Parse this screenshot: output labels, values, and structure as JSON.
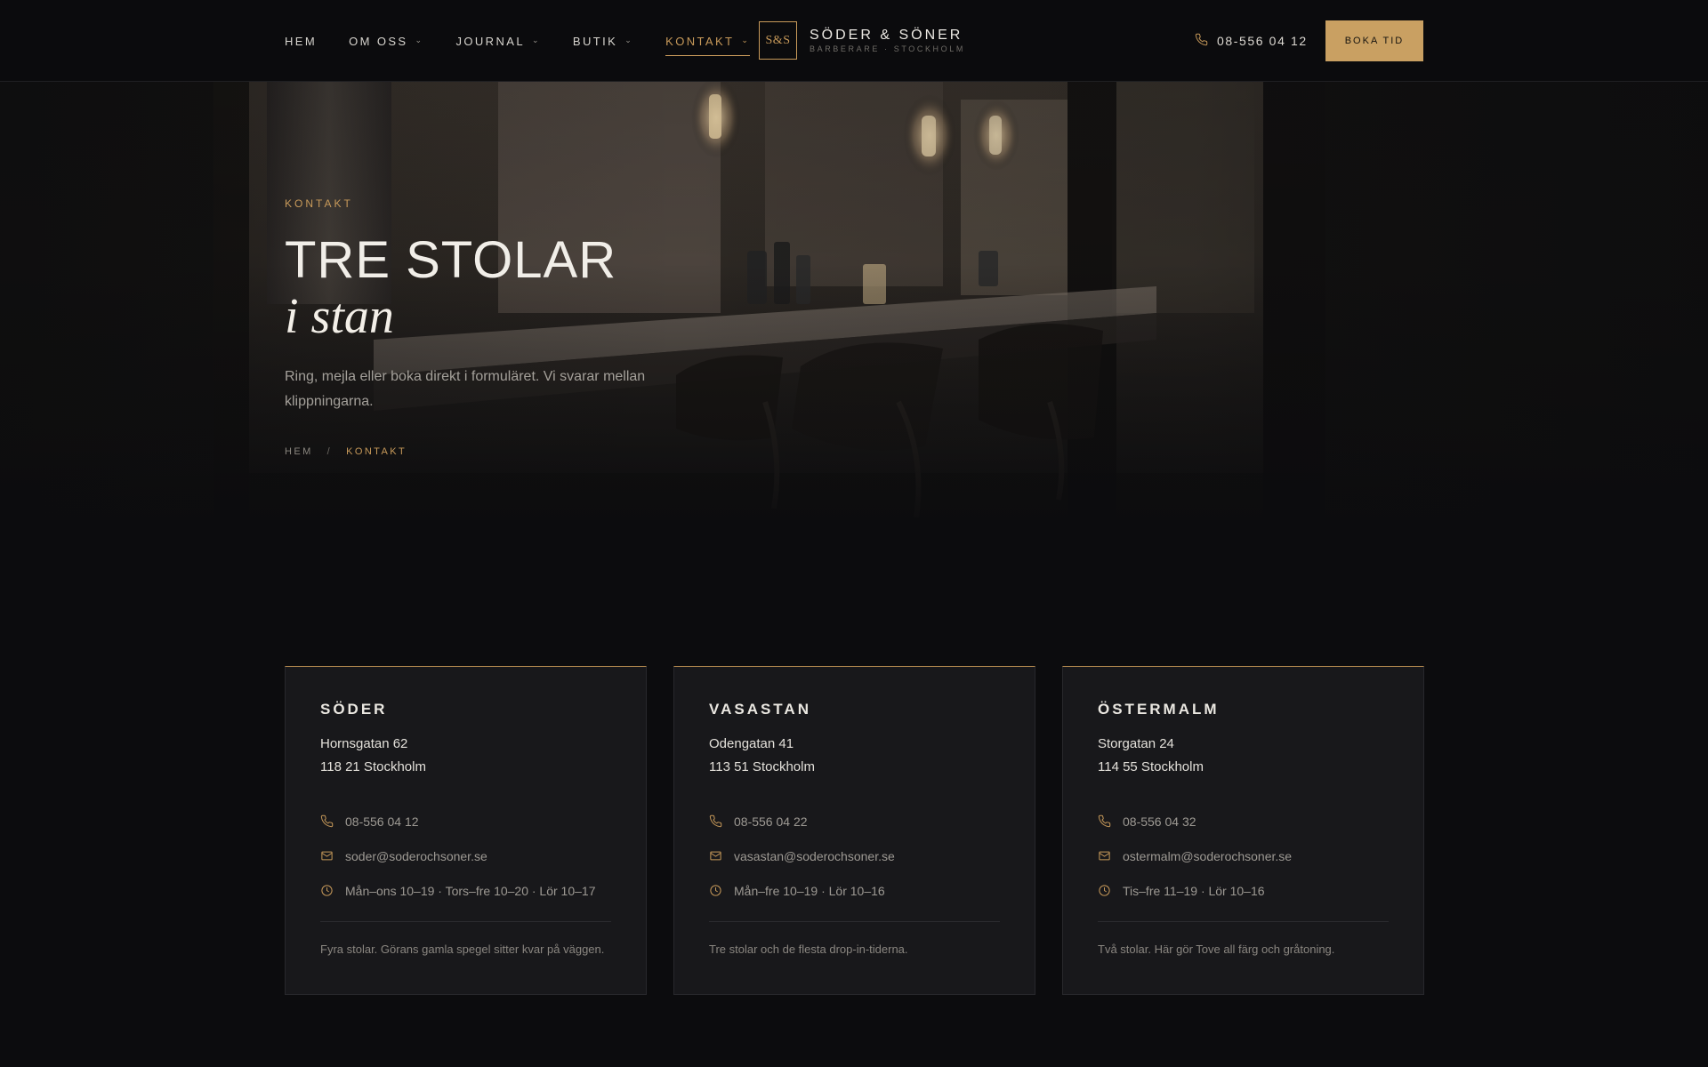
{
  "nav": {
    "items": [
      {
        "label": "HEM",
        "has_dropdown": false,
        "active": false
      },
      {
        "label": "OM OSS",
        "has_dropdown": true,
        "active": false
      },
      {
        "label": "JOURNAL",
        "has_dropdown": true,
        "active": false
      },
      {
        "label": "BUTIK",
        "has_dropdown": true,
        "active": false
      },
      {
        "label": "KONTAKT",
        "has_dropdown": true,
        "active": true
      }
    ]
  },
  "brand": {
    "mark": "S&S",
    "name": "SÖDER & SÖNER",
    "tagline": "BARBERARE · STOCKHOLM"
  },
  "header": {
    "phone": "08-556 04 12",
    "book_label": "BOKA TID"
  },
  "hero": {
    "eyebrow": "KONTAKT",
    "title": "TRE STOLAR",
    "title_italic": "i stan",
    "text": "Ring, mejla eller boka direkt i formuläret. Vi svarar mellan klippningarna.",
    "breadcrumb": {
      "home": "HEM",
      "separator": "/",
      "current": "KONTAKT"
    }
  },
  "locations": [
    {
      "name": "SÖDER",
      "street": "Hornsgatan 62",
      "city": "118 21 Stockholm",
      "phone": "08-556 04 12",
      "email": "soder@soderochsoner.se",
      "hours": "Mån–ons 10–19 · Tors–fre 10–20 · Lör 10–17",
      "note": "Fyra stolar. Görans gamla spegel sitter kvar på väggen."
    },
    {
      "name": "VASASTAN",
      "street": "Odengatan 41",
      "city": "113 51 Stockholm",
      "phone": "08-556 04 22",
      "email": "vasastan@soderochsoner.se",
      "hours": "Mån–fre 10–19 · Lör 10–16",
      "note": "Tre stolar och de flesta drop-in-tiderna."
    },
    {
      "name": "ÖSTERMALM",
      "street": "Storgatan 24",
      "city": "114 55 Stockholm",
      "phone": "08-556 04 32",
      "email": "ostermalm@soderochsoner.se",
      "hours": "Tis–fre 11–19 · Lör 10–16",
      "note": "Två stolar. Här gör Tove all färg och gråtoning."
    }
  ],
  "colors": {
    "accent": "#c89a5a",
    "button": "#c9a062",
    "background": "#0c0c0e",
    "card": "#18181b"
  },
  "icons": {
    "phone": "phone-icon",
    "email": "mail-icon",
    "hours": "clock-icon",
    "dropdown": "chevron-down-icon"
  }
}
